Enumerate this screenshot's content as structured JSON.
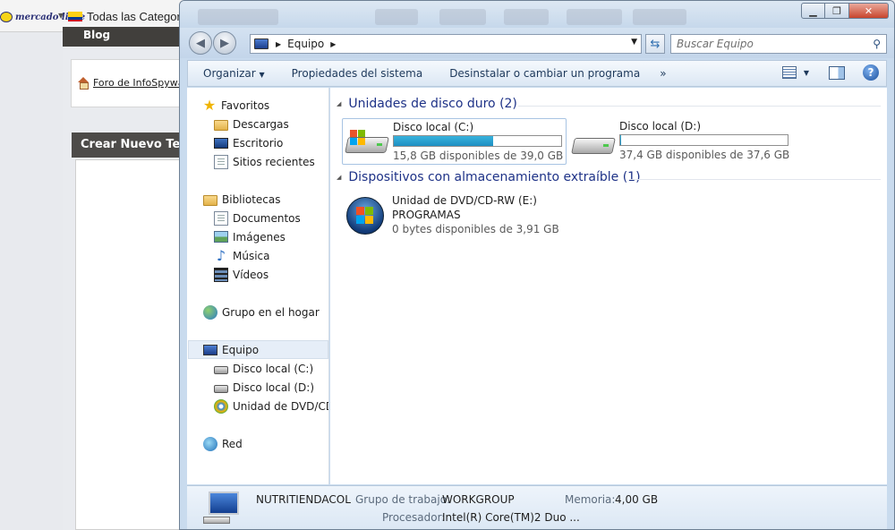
{
  "background_page": {
    "logo_text": "mercado libre",
    "categories": "Todas las Categorias",
    "blog_header": "Blog",
    "foro_link": "Foro de InfoSpywar",
    "crear_header": "Crear Nuevo Ten"
  },
  "address_bar": {
    "location": "Equipo",
    "search_placeholder": "Buscar Equipo"
  },
  "toolbar": {
    "organize": "Organizar",
    "system_properties": "Propiedades del sistema",
    "uninstall": "Desinstalar o cambiar un programa",
    "more": "»"
  },
  "nav": {
    "favorites": "Favoritos",
    "downloads": "Descargas",
    "desktop": "Escritorio",
    "recent": "Sitios recientes",
    "libraries": "Bibliotecas",
    "documents": "Documentos",
    "images": "Imágenes",
    "music": "Música",
    "videos": "Vídeos",
    "homegroup": "Grupo en el hogar",
    "computer": "Equipo",
    "drive_c": "Disco local (C:)",
    "drive_d": "Disco local (D:)",
    "dvd": "Unidad de DVD/CD-",
    "network": "Red"
  },
  "content": {
    "hdd_group": "Unidades de disco duro (2)",
    "removable_group": "Dispositivos con almacenamiento extraíble (1)",
    "drives": [
      {
        "name": "Disco local (C:)",
        "space": "15,8 GB disponibles de 39,0 GB",
        "used_fraction": 0.595
      },
      {
        "name": "Disco local (D:)",
        "space": "37,4 GB disponibles de 37,6 GB",
        "used_fraction": 0.005
      }
    ],
    "dvd": {
      "name": "Unidad de DVD/CD-RW (E:)",
      "label": "PROGRAMAS",
      "space": "0 bytes disponibles de 3,91 GB"
    }
  },
  "details": {
    "computer_name": "NUTRITIENDACOL",
    "workgroup_label": "Grupo de trabajo:",
    "workgroup_value": "WORKGROUP",
    "memory_label": "Memoria:",
    "memory_value": "4,00 GB",
    "processor_label": "Procesador:",
    "processor_value": "Intel(R) Core(TM)2 Duo ..."
  },
  "colors": {
    "group_title": "#1e3287",
    "bar_fill": "#26a0d2",
    "window_frame": "#c9dbee"
  }
}
